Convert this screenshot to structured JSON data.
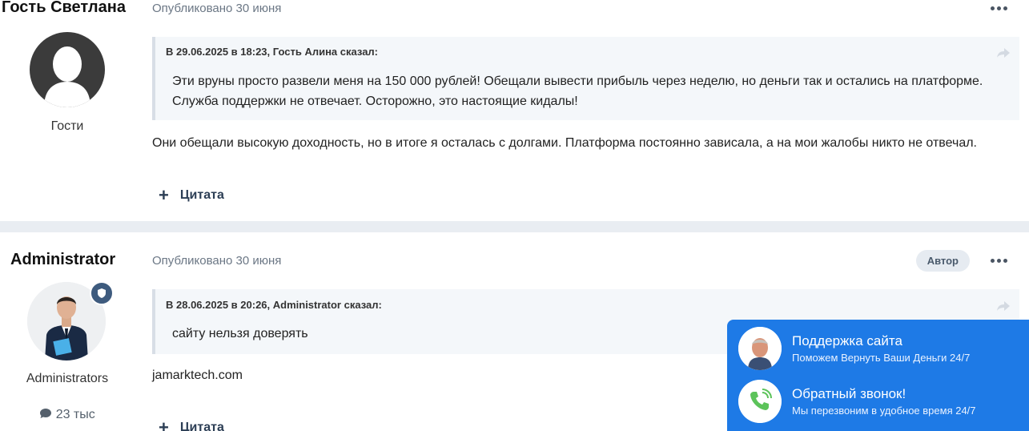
{
  "posts": [
    {
      "author": "Гость Светлана",
      "group": "Гости",
      "posted": "Опубликовано 30 июня",
      "quote_header": "В 29.06.2025 в 18:23, Гость Алина сказал:",
      "quote_lines": [
        "Эти вруны просто развели меня на 150 000 рублей! Обещали вывести прибыль через неделю, но деньги так и остались на платформе.",
        "Служба поддержки не отвечает. Осторожно, это настоящие кидалы!"
      ],
      "body": "Они обещали высокую доходность, но в итоге я осталась с долгами. Платформа постоянно зависала, а на мои жалобы никто не отвечал.",
      "cite_label": "Цитата"
    },
    {
      "author": "Administrator",
      "group": "Administrators",
      "stat": "23 тыс",
      "posted": "Опубликовано 30 июня",
      "author_badge": "Автор",
      "quote_header": "В 28.06.2025 в 20:26, Administrator сказал:",
      "quote_text": "сайту нельзя доверять",
      "body": "jamarktech.com",
      "cite_label": "Цитата"
    }
  ],
  "widget": {
    "support": {
      "title": "Поддержка сайта",
      "subtitle": "Поможем Вернуть Ваши Деньги 24/7"
    },
    "callback": {
      "title": "Обратный звонок!",
      "subtitle": "Мы перезвоним в удобное время 24/7"
    }
  }
}
